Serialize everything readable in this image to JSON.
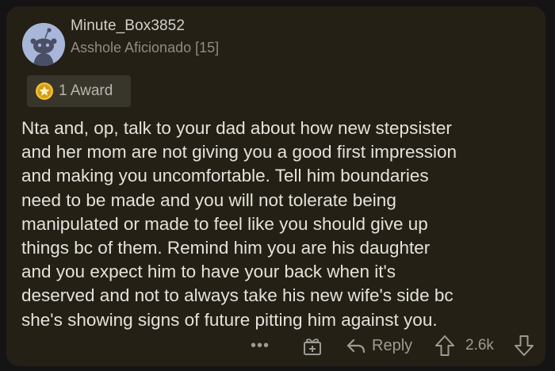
{
  "comment": {
    "username": "Minute_Box3852",
    "flair": "Asshole Aficionado [15]",
    "award_label": "1 Award",
    "body": "Nta and,  op, talk to your dad about how new stepsister\nand her mom are not giving you a good first impression\nand making you uncomfortable.   Tell him boundaries\nneed to be made and you will not tolerate being\nmanipulated or made to feel like you should give up\nthings bc of them.  Remind him you are his daughter\nand you expect him to have your back when it's\ndeserved and not to always take his new wife's side bc\nshe's showing signs of future pitting him against you."
  },
  "actions": {
    "more_label": "•••",
    "reply_label": "Reply",
    "score": "2.6k"
  },
  "icons": {
    "avatar": "snoo-avatar-icon",
    "award": "award-badge-icon",
    "give_award": "give-award-icon",
    "reply": "reply-arrow-icon",
    "upvote": "upvote-arrow-icon",
    "downvote": "downvote-arrow-icon"
  },
  "colors": {
    "background": "#151414",
    "card": "#242015",
    "text": "#e3e2dc",
    "muted": "#9c9b93",
    "avatar": "#a8b6d9"
  }
}
